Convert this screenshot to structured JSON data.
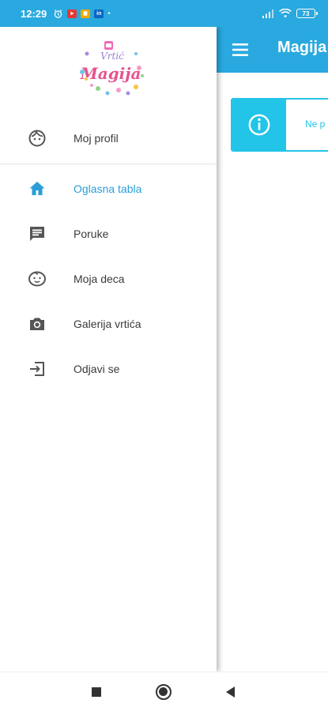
{
  "status_bar": {
    "time": "12:29",
    "battery": "73",
    "notification_icons": [
      "alarm-icon",
      "youtube-icon",
      "note-app-icon",
      "linkedin-icon"
    ],
    "linkedin_label": "in"
  },
  "app_bar": {
    "title": "Magija"
  },
  "alert": {
    "text": "Ne p"
  },
  "drawer": {
    "logo_text_top": "Vrtić",
    "logo_text_main": "Magija",
    "profile": {
      "label": "Moj profil",
      "icon": "face-icon"
    },
    "items": [
      {
        "label": "Oglasna tabla",
        "icon": "home-icon",
        "active": true
      },
      {
        "label": "Poruke",
        "icon": "message-icon",
        "active": false
      },
      {
        "label": "Moja deca",
        "icon": "child-face-icon",
        "active": false
      },
      {
        "label": "Galerija vrtića",
        "icon": "camera-icon",
        "active": false
      },
      {
        "label": "Odjavi se",
        "icon": "logout-icon",
        "active": false
      }
    ]
  },
  "colors": {
    "primary": "#29a9df",
    "active_item": "#2a9ed8",
    "alert": "#22c4e8"
  }
}
